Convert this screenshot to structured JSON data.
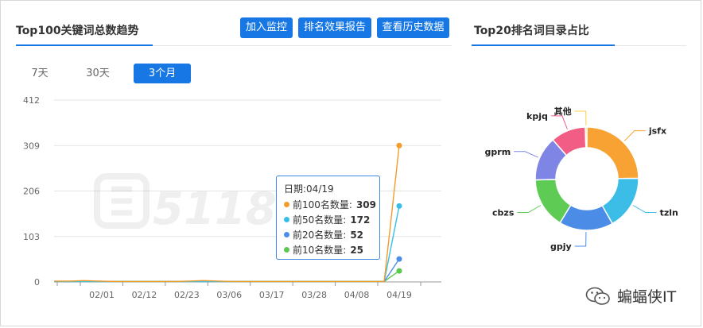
{
  "left_panel": {
    "title": "Top100关键词总数趋势",
    "buttons": {
      "add_monitor": "加入监控",
      "ranking_report": "排名效果报告",
      "history_data": "查看历史数据"
    },
    "ranges": [
      "7天",
      "30天",
      "3个月"
    ],
    "active_range": "3个月"
  },
  "right_panel": {
    "title": "Top20排名词目录占比"
  },
  "tooltip": {
    "date": "日期:04/19",
    "rows": [
      {
        "label": "前100名数量:",
        "value": "309",
        "color": "#f39c2b"
      },
      {
        "label": "前50名数量:",
        "value": "172",
        "color": "#35bfe8"
      },
      {
        "label": "前20名数量:",
        "value": "52",
        "color": "#4a8fe6"
      },
      {
        "label": "前10名数量:",
        "value": "25",
        "color": "#5bc84f"
      }
    ]
  },
  "watermark": {
    "text": "蝙蝠侠IT"
  },
  "chart_data": [
    {
      "type": "line",
      "title": "Top100关键词总数趋势",
      "x_ticks": [
        "02/01",
        "02/12",
        "02/23",
        "03/06",
        "03/17",
        "03/28",
        "04/08",
        "04/19"
      ],
      "y_ticks": [
        0,
        103,
        206,
        309,
        412
      ],
      "ylim": [
        0,
        412
      ],
      "grid": true,
      "series": [
        {
          "name": "前100名数量",
          "color": "#f39c2b",
          "values": [
            2,
            2,
            3,
            2,
            1,
            1,
            1,
            1,
            1,
            2,
            3,
            2,
            1,
            1,
            1,
            1,
            1,
            1,
            1,
            1,
            1,
            1,
            1,
            309
          ]
        },
        {
          "name": "前50名数量",
          "color": "#35bfe8",
          "values": [
            1,
            1,
            1,
            1,
            1,
            1,
            1,
            1,
            1,
            1,
            1,
            1,
            1,
            1,
            1,
            1,
            1,
            1,
            1,
            1,
            1,
            1,
            1,
            172
          ]
        },
        {
          "name": "前20名数量",
          "color": "#4a8fe6",
          "values": [
            1,
            1,
            1,
            1,
            1,
            1,
            1,
            1,
            1,
            1,
            1,
            1,
            1,
            1,
            1,
            1,
            1,
            1,
            1,
            1,
            1,
            1,
            1,
            52
          ]
        },
        {
          "name": "前10名数量",
          "color": "#5bc84f",
          "values": [
            1,
            1,
            1,
            1,
            1,
            1,
            1,
            1,
            1,
            1,
            1,
            1,
            1,
            1,
            1,
            1,
            1,
            1,
            1,
            1,
            1,
            1,
            1,
            25
          ]
        }
      ]
    },
    {
      "type": "pie",
      "title": "Top20排名词目录占比",
      "slices": [
        {
          "label": "jsfx",
          "value": 25,
          "color": "#f7a233"
        },
        {
          "label": "tzln",
          "value": 17,
          "color": "#3bbde8"
        },
        {
          "label": "gpjy",
          "value": 17,
          "color": "#4b8de6"
        },
        {
          "label": "cbzs",
          "value": 16,
          "color": "#5ecb55"
        },
        {
          "label": "gprm",
          "value": 14,
          "color": "#7f85e4"
        },
        {
          "label": "kpjq",
          "value": 11,
          "color": "#f25d86"
        },
        {
          "label": "其他",
          "value": 0.5,
          "color": "#f7d24a"
        }
      ]
    }
  ]
}
